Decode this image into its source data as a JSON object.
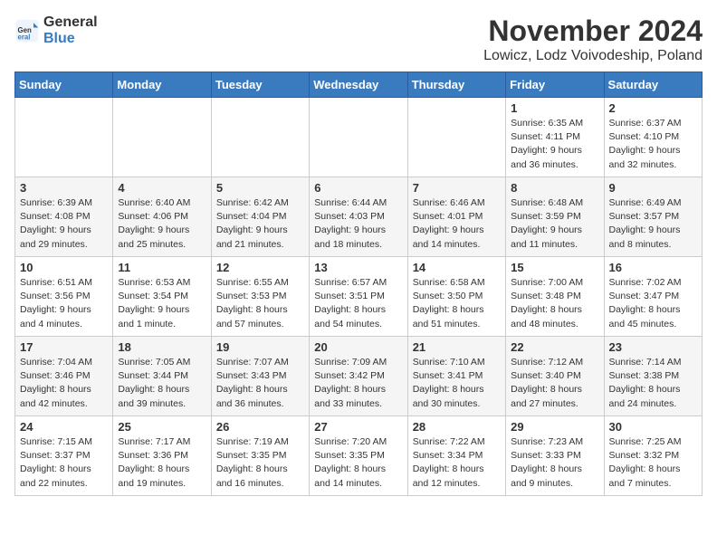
{
  "header": {
    "logo_general": "General",
    "logo_blue": "Blue",
    "month_title": "November 2024",
    "location": "Lowicz, Lodz Voivodeship, Poland"
  },
  "weekdays": [
    "Sunday",
    "Monday",
    "Tuesday",
    "Wednesday",
    "Thursday",
    "Friday",
    "Saturday"
  ],
  "weeks": [
    [
      {
        "day": "",
        "info": ""
      },
      {
        "day": "",
        "info": ""
      },
      {
        "day": "",
        "info": ""
      },
      {
        "day": "",
        "info": ""
      },
      {
        "day": "",
        "info": ""
      },
      {
        "day": "1",
        "info": "Sunrise: 6:35 AM\nSunset: 4:11 PM\nDaylight: 9 hours\nand 36 minutes."
      },
      {
        "day": "2",
        "info": "Sunrise: 6:37 AM\nSunset: 4:10 PM\nDaylight: 9 hours\nand 32 minutes."
      }
    ],
    [
      {
        "day": "3",
        "info": "Sunrise: 6:39 AM\nSunset: 4:08 PM\nDaylight: 9 hours\nand 29 minutes."
      },
      {
        "day": "4",
        "info": "Sunrise: 6:40 AM\nSunset: 4:06 PM\nDaylight: 9 hours\nand 25 minutes."
      },
      {
        "day": "5",
        "info": "Sunrise: 6:42 AM\nSunset: 4:04 PM\nDaylight: 9 hours\nand 21 minutes."
      },
      {
        "day": "6",
        "info": "Sunrise: 6:44 AM\nSunset: 4:03 PM\nDaylight: 9 hours\nand 18 minutes."
      },
      {
        "day": "7",
        "info": "Sunrise: 6:46 AM\nSunset: 4:01 PM\nDaylight: 9 hours\nand 14 minutes."
      },
      {
        "day": "8",
        "info": "Sunrise: 6:48 AM\nSunset: 3:59 PM\nDaylight: 9 hours\nand 11 minutes."
      },
      {
        "day": "9",
        "info": "Sunrise: 6:49 AM\nSunset: 3:57 PM\nDaylight: 9 hours\nand 8 minutes."
      }
    ],
    [
      {
        "day": "10",
        "info": "Sunrise: 6:51 AM\nSunset: 3:56 PM\nDaylight: 9 hours\nand 4 minutes."
      },
      {
        "day": "11",
        "info": "Sunrise: 6:53 AM\nSunset: 3:54 PM\nDaylight: 9 hours\nand 1 minute."
      },
      {
        "day": "12",
        "info": "Sunrise: 6:55 AM\nSunset: 3:53 PM\nDaylight: 8 hours\nand 57 minutes."
      },
      {
        "day": "13",
        "info": "Sunrise: 6:57 AM\nSunset: 3:51 PM\nDaylight: 8 hours\nand 54 minutes."
      },
      {
        "day": "14",
        "info": "Sunrise: 6:58 AM\nSunset: 3:50 PM\nDaylight: 8 hours\nand 51 minutes."
      },
      {
        "day": "15",
        "info": "Sunrise: 7:00 AM\nSunset: 3:48 PM\nDaylight: 8 hours\nand 48 minutes."
      },
      {
        "day": "16",
        "info": "Sunrise: 7:02 AM\nSunset: 3:47 PM\nDaylight: 8 hours\nand 45 minutes."
      }
    ],
    [
      {
        "day": "17",
        "info": "Sunrise: 7:04 AM\nSunset: 3:46 PM\nDaylight: 8 hours\nand 42 minutes."
      },
      {
        "day": "18",
        "info": "Sunrise: 7:05 AM\nSunset: 3:44 PM\nDaylight: 8 hours\nand 39 minutes."
      },
      {
        "day": "19",
        "info": "Sunrise: 7:07 AM\nSunset: 3:43 PM\nDaylight: 8 hours\nand 36 minutes."
      },
      {
        "day": "20",
        "info": "Sunrise: 7:09 AM\nSunset: 3:42 PM\nDaylight: 8 hours\nand 33 minutes."
      },
      {
        "day": "21",
        "info": "Sunrise: 7:10 AM\nSunset: 3:41 PM\nDaylight: 8 hours\nand 30 minutes."
      },
      {
        "day": "22",
        "info": "Sunrise: 7:12 AM\nSunset: 3:40 PM\nDaylight: 8 hours\nand 27 minutes."
      },
      {
        "day": "23",
        "info": "Sunrise: 7:14 AM\nSunset: 3:38 PM\nDaylight: 8 hours\nand 24 minutes."
      }
    ],
    [
      {
        "day": "24",
        "info": "Sunrise: 7:15 AM\nSunset: 3:37 PM\nDaylight: 8 hours\nand 22 minutes."
      },
      {
        "day": "25",
        "info": "Sunrise: 7:17 AM\nSunset: 3:36 PM\nDaylight: 8 hours\nand 19 minutes."
      },
      {
        "day": "26",
        "info": "Sunrise: 7:19 AM\nSunset: 3:35 PM\nDaylight: 8 hours\nand 16 minutes."
      },
      {
        "day": "27",
        "info": "Sunrise: 7:20 AM\nSunset: 3:35 PM\nDaylight: 8 hours\nand 14 minutes."
      },
      {
        "day": "28",
        "info": "Sunrise: 7:22 AM\nSunset: 3:34 PM\nDaylight: 8 hours\nand 12 minutes."
      },
      {
        "day": "29",
        "info": "Sunrise: 7:23 AM\nSunset: 3:33 PM\nDaylight: 8 hours\nand 9 minutes."
      },
      {
        "day": "30",
        "info": "Sunrise: 7:25 AM\nSunset: 3:32 PM\nDaylight: 8 hours\nand 7 minutes."
      }
    ]
  ]
}
